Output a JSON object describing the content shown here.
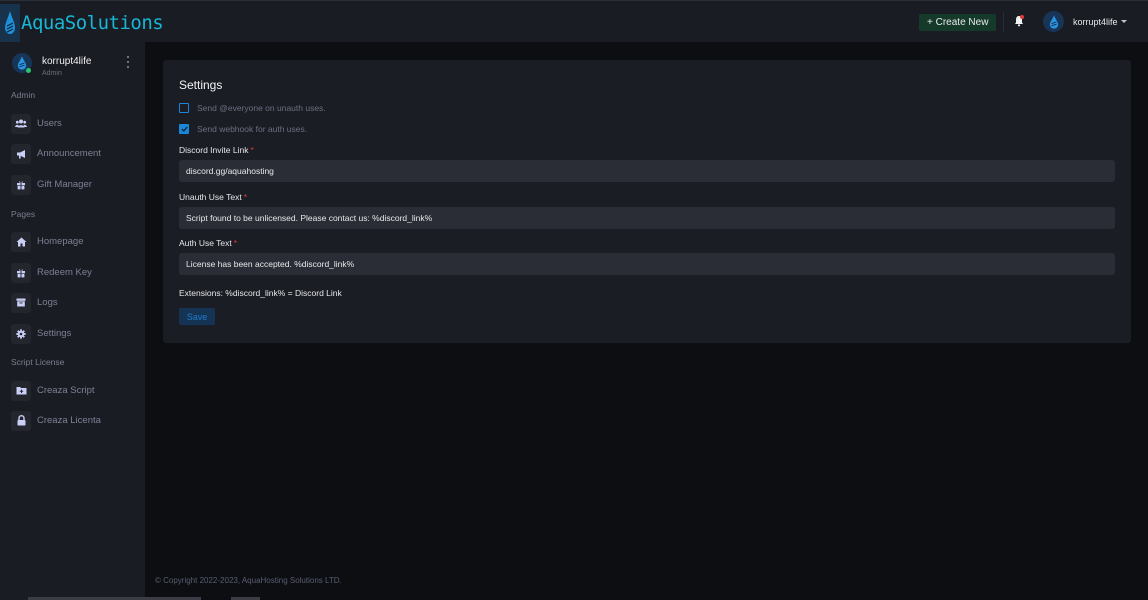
{
  "brand": {
    "name": "AquaSolutions"
  },
  "topbar": {
    "create_label": "+ Create New",
    "username": "korrupt4life",
    "notification_badge_color": "#e53a3a"
  },
  "sidebar": {
    "profile": {
      "name": "korrupt4life",
      "role": "Admin",
      "status": "online"
    },
    "sections": [
      {
        "title": "Admin",
        "items": [
          {
            "label": "Users",
            "icon": "users-icon"
          },
          {
            "label": "Announcement",
            "icon": "megaphone-icon"
          },
          {
            "label": "Gift Manager",
            "icon": "gift-icon"
          }
        ]
      },
      {
        "title": "Pages",
        "items": [
          {
            "label": "Homepage",
            "icon": "home-icon"
          },
          {
            "label": "Redeem Key",
            "icon": "gift-icon"
          },
          {
            "label": "Logs",
            "icon": "archive-icon"
          },
          {
            "label": "Settings",
            "icon": "gear-icon"
          }
        ]
      },
      {
        "title": "Script License",
        "items": [
          {
            "label": "Creaza Script",
            "icon": "folder-plus-icon"
          },
          {
            "label": "Creaza Licenta",
            "icon": "lock-icon"
          }
        ]
      }
    ]
  },
  "settings": {
    "title": "Settings",
    "checkboxes": [
      {
        "label": "Send @everyone on unauth uses.",
        "checked": false
      },
      {
        "label": "Send webhook for auth uses.",
        "checked": true
      }
    ],
    "fields": [
      {
        "label": "Discord Invite Link",
        "required_mark": "*",
        "value": "discord.gg/aquahosting"
      },
      {
        "label": "Unauth Use Text",
        "required_mark": "*",
        "value": "Script found to be unlicensed. Please contact us: %discord_link%"
      },
      {
        "label": "Auth Use Text",
        "required_mark": "*",
        "value": "License has been accepted. %discord_link%"
      }
    ],
    "extensions_note": "Extensions: %discord_link% = Discord Link",
    "save_label": "Save"
  },
  "footer": {
    "copyright": "© Copyright 2022-2023, AquaHosting Solutions LTD."
  },
  "colors": {
    "accent": "#1a86d8",
    "brand": "#18b6d6",
    "create_button": "#163a2a"
  }
}
